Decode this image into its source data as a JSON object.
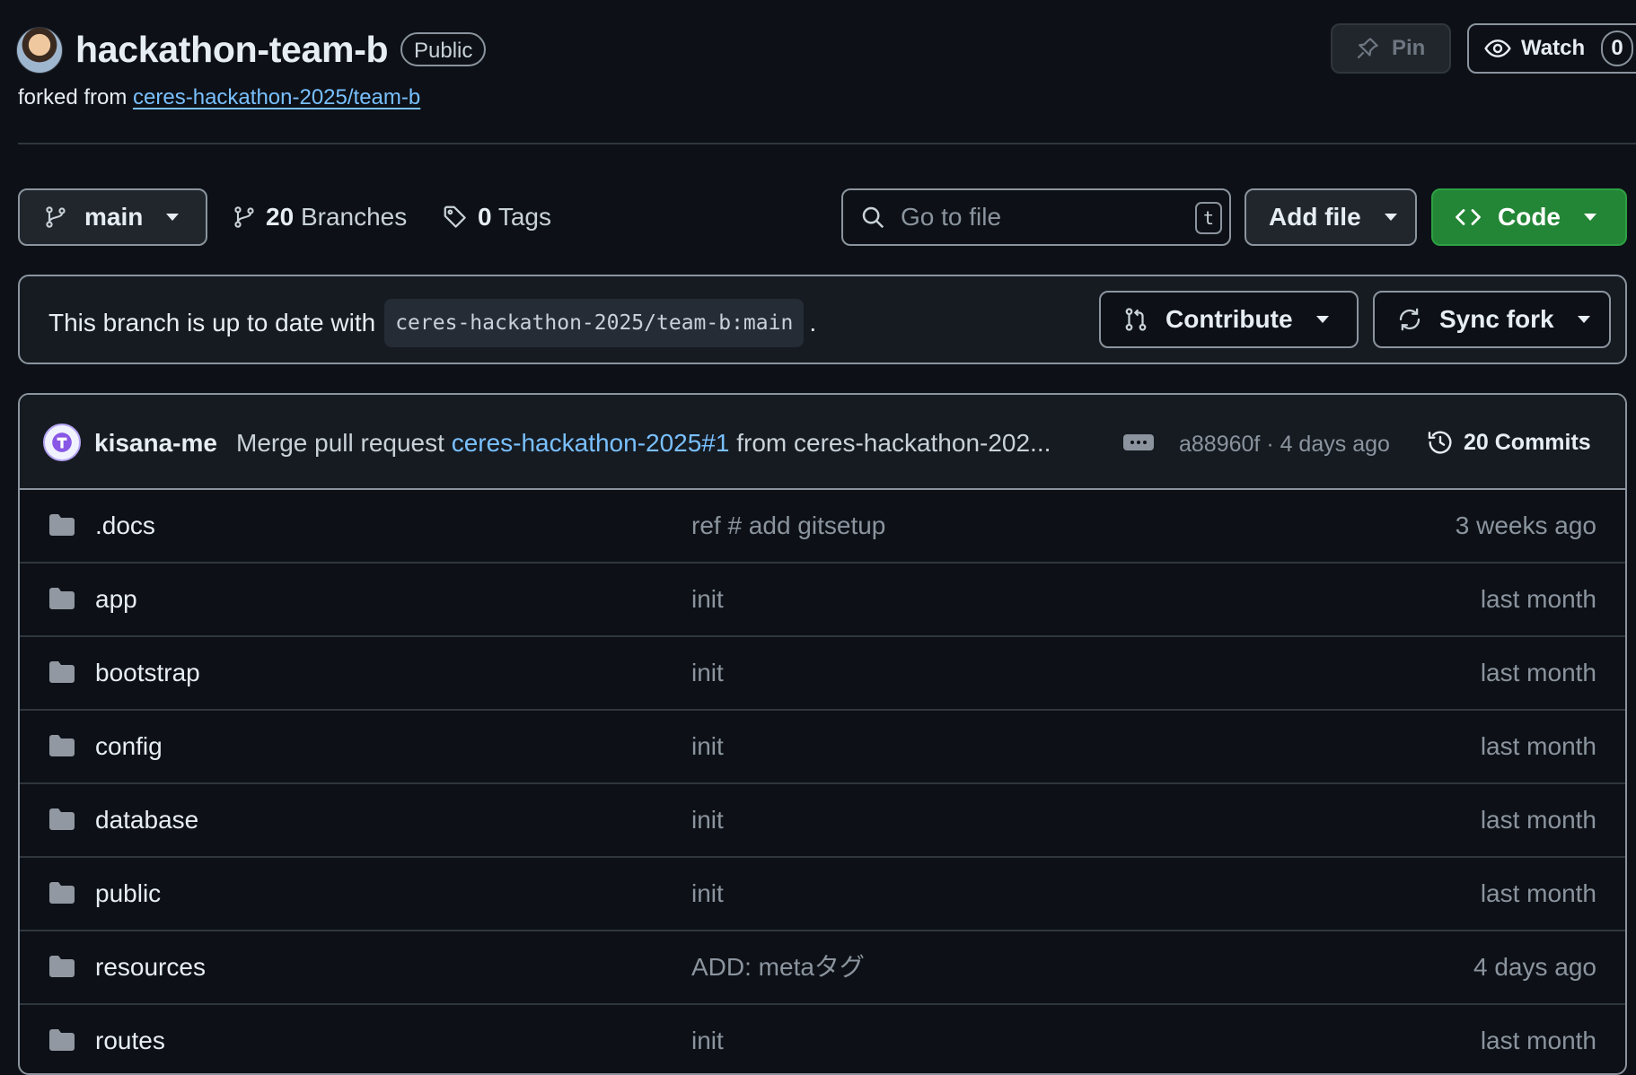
{
  "repo": {
    "name": "hackathon-team-b",
    "visibility": "Public",
    "forked_prefix": "forked from",
    "forked_from": "ceres-hackathon-2025/team-b"
  },
  "actions": {
    "pin_label": "Pin",
    "watch_label": "Watch",
    "watch_count": "0"
  },
  "toolbar": {
    "branch": "main",
    "branches_count": "20",
    "branches_label": "Branches",
    "tags_count": "0",
    "tags_label": "Tags",
    "search_placeholder": "Go to file",
    "search_shortcut": "t",
    "add_file_label": "Add file",
    "code_label": "Code"
  },
  "fork_status": {
    "message": "This branch is up to date with",
    "ref": "ceres-hackathon-2025/team-b:main",
    "suffix": ".",
    "contribute_label": "Contribute",
    "sync_label": "Sync fork"
  },
  "latest_commit": {
    "author": "kisana-me",
    "message_prefix": "Merge pull request",
    "pr_link": "ceres-hackathon-2025#1",
    "message_suffix": "from ceres-hackathon-202...",
    "sha_time": "a88960f · 4 days ago",
    "commits_label": "20 Commits"
  },
  "files": [
    {
      "name": ".docs",
      "message": "ref # add gitsetup",
      "date": "3 weeks ago",
      "icon": "folder-icon"
    },
    {
      "name": "app",
      "message": "init",
      "date": "last month",
      "icon": "folder-icon"
    },
    {
      "name": "bootstrap",
      "message": "init",
      "date": "last month",
      "icon": "folder-icon"
    },
    {
      "name": "config",
      "message": "init",
      "date": "last month",
      "icon": "folder-icon"
    },
    {
      "name": "database",
      "message": "init",
      "date": "last month",
      "icon": "folder-icon"
    },
    {
      "name": "public",
      "message": "init",
      "date": "last month",
      "icon": "folder-icon"
    },
    {
      "name": "resources",
      "message": "ADD: metaタグ",
      "date": "4 days ago",
      "icon": "folder-icon"
    },
    {
      "name": "routes",
      "message": "init",
      "date": "last month",
      "icon": "folder-icon"
    }
  ],
  "colors": {
    "background": "#0d1117",
    "link": "#79c0ff",
    "code_button": "#238636",
    "muted_text": "#8b949e",
    "border": "#30363d"
  }
}
